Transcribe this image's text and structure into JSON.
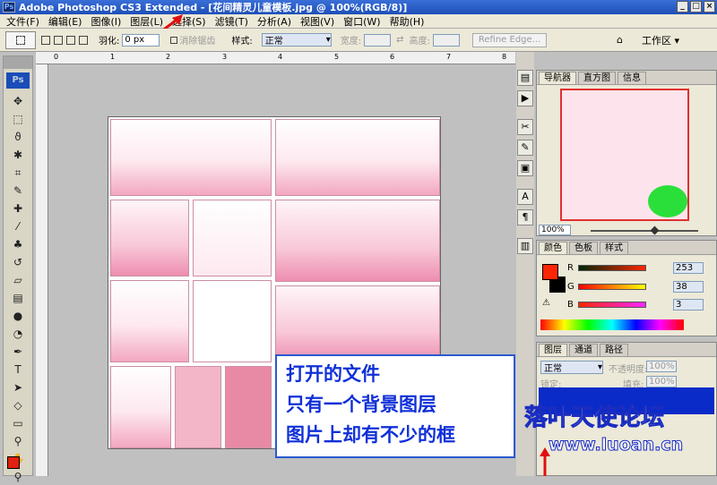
{
  "title": "Adobe Photoshop CS3 Extended - [花间精灵儿童模板.jpg @ 100%(RGB/8)]",
  "window_buttons": [
    "_",
    "□",
    "×"
  ],
  "menu": [
    "文件(F)",
    "编辑(E)",
    "图像(I)",
    "图层(L)",
    "选择(S)",
    "滤镜(T)",
    "分析(A)",
    "视图(V)",
    "窗口(W)",
    "帮助(H)"
  ],
  "options": {
    "feather_label": "羽化:",
    "feather_value": "0 px",
    "antialias_label": "消除锯齿",
    "style_label": "样式:",
    "style_value": "正常",
    "width_label": "宽度:",
    "height_label": "高度:",
    "refine_edge": "Refine Edge...",
    "workspace": "工作区 ▾"
  },
  "toolbox": {
    "logo": "Ps",
    "tools": [
      "move-tool",
      "marquee-tool",
      "lasso-tool",
      "magic-wand-tool",
      "crop-tool",
      "slice-tool",
      "healing-tool",
      "brush-tool",
      "stamp-tool",
      "history-brush-tool",
      "eraser-tool",
      "gradient-tool",
      "blur-tool",
      "dodge-tool",
      "pen-tool",
      "type-tool",
      "path-select-tool",
      "shape-tool",
      "notes-tool",
      "eyedropper-tool",
      "hand-tool",
      "zoom-tool"
    ]
  },
  "ruler_ticks": [
    "0",
    "1",
    "2",
    "3",
    "4",
    "5",
    "6",
    "7",
    "8"
  ],
  "navigator": {
    "tabs": [
      "导航器",
      "直方图",
      "信息"
    ],
    "zoom": "100%"
  },
  "color_panel": {
    "tabs": [
      "颜色",
      "色板",
      "样式"
    ],
    "r_label": "R",
    "r_value": "253",
    "g_label": "G",
    "g_value": "38",
    "b_label": "B",
    "b_value": "3",
    "fg_color": "#fd2603"
  },
  "layers_panel": {
    "tabs": [
      "图层",
      "通道",
      "路径"
    ],
    "blend_mode": "正常",
    "opacity_label": "不透明度:",
    "opacity_value": "100%",
    "lock_label": "锁定:",
    "fill_label": "填充:",
    "fill_value": "100%"
  },
  "annotation": {
    "line1": "打开的文件",
    "line2": "只有一个背景图层",
    "line3": "图片上却有不少的框"
  },
  "watermark": "落叶天使论坛",
  "watermark_url": "www.luoan.cn"
}
